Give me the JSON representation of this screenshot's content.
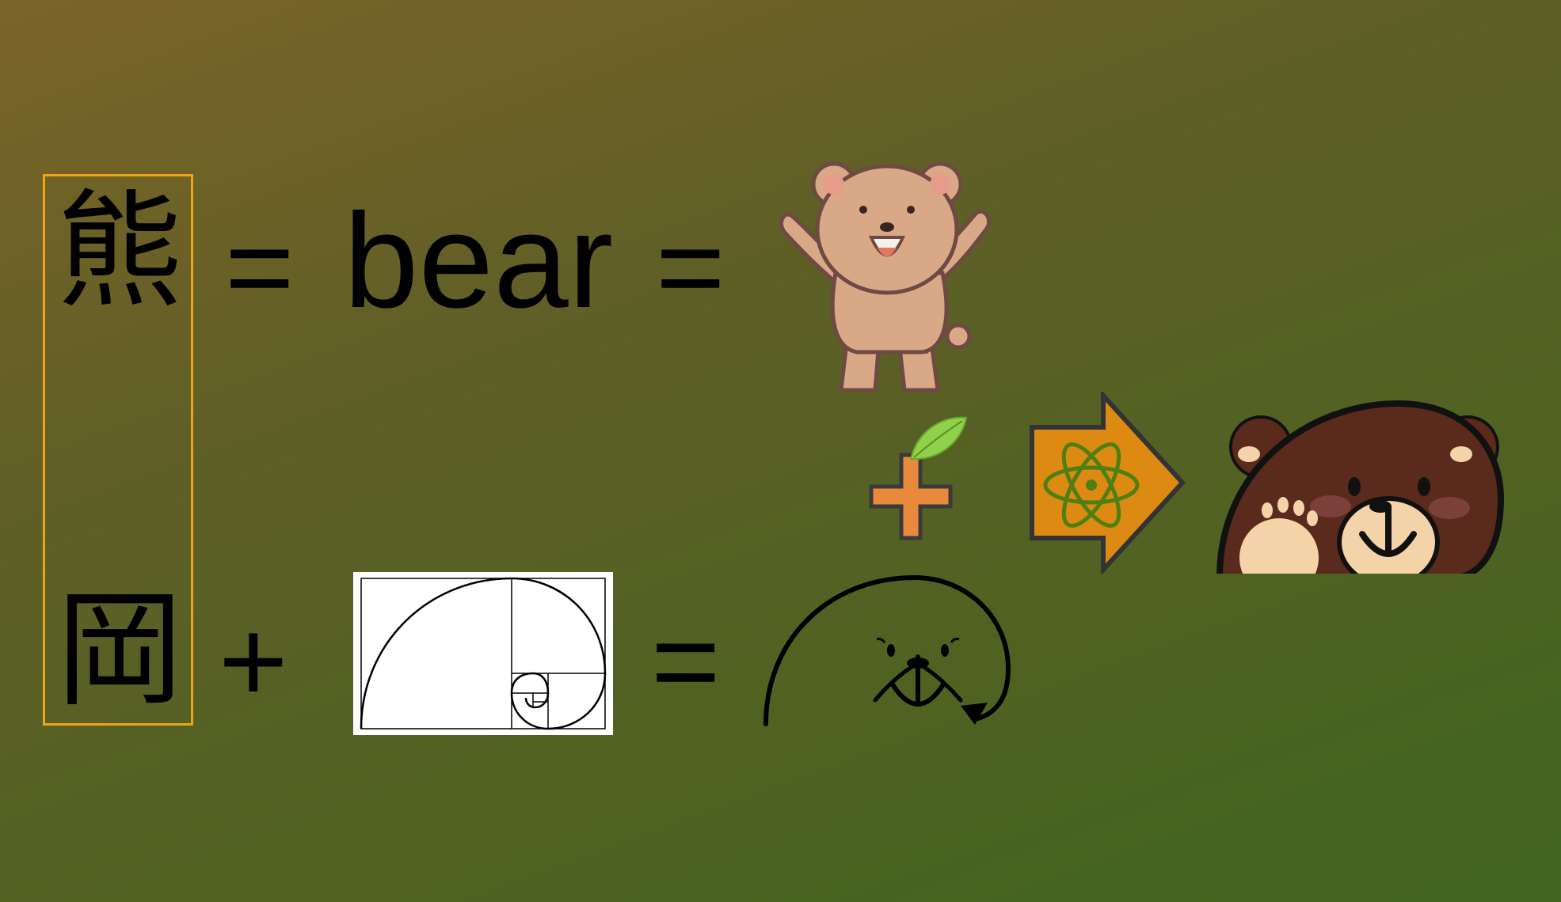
{
  "row1": {
    "kanji": "熊",
    "equals_1": "=",
    "word": "bear",
    "equals_2": "="
  },
  "row2": {
    "kanji": "岡",
    "plus": "+",
    "equals": "="
  },
  "icons": {
    "bear_illustration": "standing-bear-icon",
    "leaf_plus": "plus-leaf-icon",
    "arrow": "atom-arrow-icon",
    "bear_logo": "bear-face-logo-icon",
    "golden_spiral": "golden-spiral-icon",
    "spiral_bear": "spiral-bear-face-icon"
  },
  "colors": {
    "frame": "#f1a415",
    "plus_orange": "#e8893c",
    "arrow_fill": "#dd8a12",
    "atom": "#4f7f12",
    "leaf": "#8fd14a",
    "bear_brown": "#5a2a1c"
  }
}
